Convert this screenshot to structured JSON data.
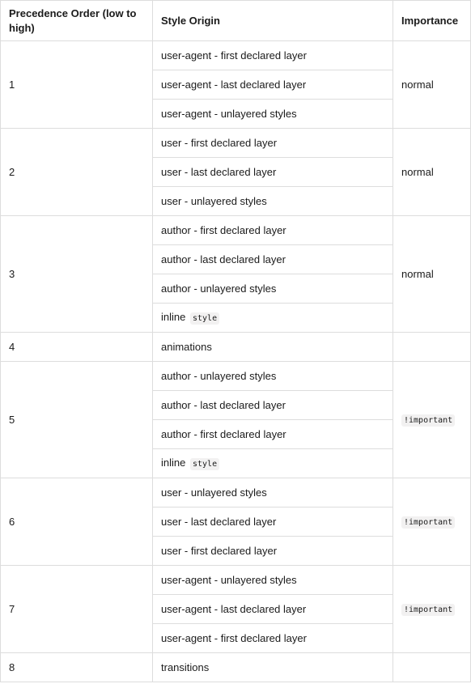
{
  "headers": {
    "order": "Precedence Order (low to high)",
    "origin": "Style Origin",
    "importance": "Importance"
  },
  "groups": [
    {
      "order": "1",
      "importance": "normal",
      "importance_is_code": false,
      "origins": [
        {
          "text": "user-agent - first declared layer",
          "code": ""
        },
        {
          "text": "user-agent - last declared layer",
          "code": ""
        },
        {
          "text": "user-agent - unlayered styles",
          "code": ""
        }
      ]
    },
    {
      "order": "2",
      "importance": "normal",
      "importance_is_code": false,
      "origins": [
        {
          "text": "user - first declared layer",
          "code": ""
        },
        {
          "text": "user - last declared layer",
          "code": ""
        },
        {
          "text": "user - unlayered styles",
          "code": ""
        }
      ]
    },
    {
      "order": "3",
      "importance": "normal",
      "importance_is_code": false,
      "origins": [
        {
          "text": "author - first declared layer",
          "code": ""
        },
        {
          "text": "author - last declared layer",
          "code": ""
        },
        {
          "text": "author - unlayered styles",
          "code": ""
        },
        {
          "text": "inline",
          "code": "style"
        }
      ]
    },
    {
      "order": "4",
      "importance": "",
      "importance_is_code": false,
      "origins": [
        {
          "text": "animations",
          "code": ""
        }
      ]
    },
    {
      "order": "5",
      "importance": "!important",
      "importance_is_code": true,
      "origins": [
        {
          "text": "author - unlayered styles",
          "code": ""
        },
        {
          "text": "author - last declared layer",
          "code": ""
        },
        {
          "text": "author - first declared layer",
          "code": ""
        },
        {
          "text": "inline",
          "code": "style"
        }
      ]
    },
    {
      "order": "6",
      "importance": "!important",
      "importance_is_code": true,
      "origins": [
        {
          "text": "user - unlayered styles",
          "code": ""
        },
        {
          "text": "user - last declared layer",
          "code": ""
        },
        {
          "text": "user - first declared layer",
          "code": ""
        }
      ]
    },
    {
      "order": "7",
      "importance": "!important",
      "importance_is_code": true,
      "origins": [
        {
          "text": "user-agent - unlayered styles",
          "code": ""
        },
        {
          "text": "user-agent - last declared layer",
          "code": ""
        },
        {
          "text": "user-agent - first declared layer",
          "code": ""
        }
      ]
    },
    {
      "order": "8",
      "importance": "",
      "importance_is_code": false,
      "origins": [
        {
          "text": "transitions",
          "code": ""
        }
      ]
    }
  ]
}
